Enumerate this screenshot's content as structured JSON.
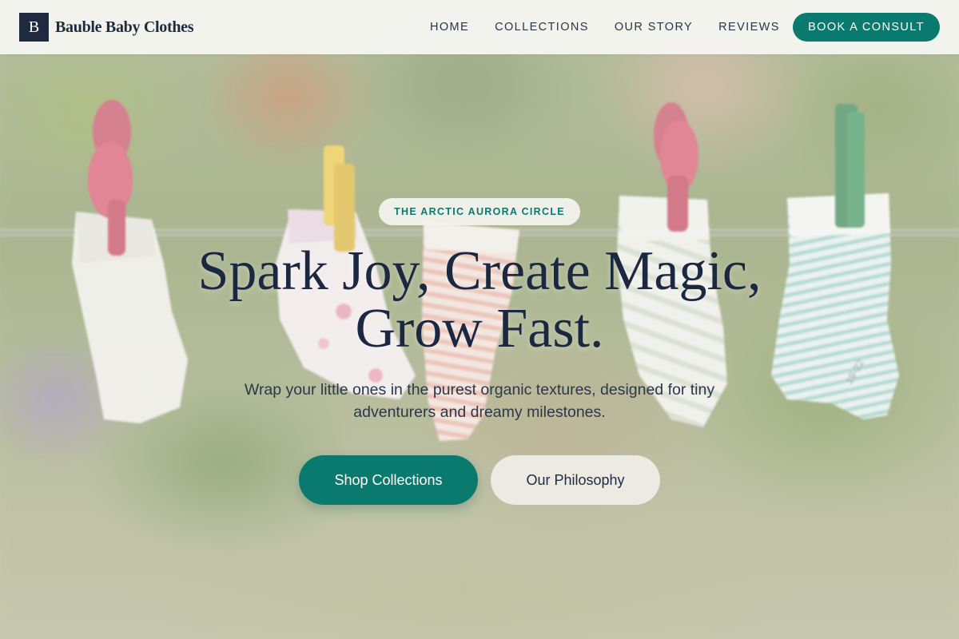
{
  "brand": {
    "mark": "B",
    "name": "Bauble Baby Clothes"
  },
  "nav": {
    "items": [
      {
        "label": "HOME"
      },
      {
        "label": "COLLECTIONS"
      },
      {
        "label": "OUR STORY"
      },
      {
        "label": "REVIEWS"
      }
    ],
    "cta_label": "BOOK A CONSULT"
  },
  "hero": {
    "eyebrow": "THE ARCTIC AURORA CIRCLE",
    "title_line1": "Spark Joy, Create Magic,",
    "title_line2": "Grow Fast.",
    "subtitle": "Wrap your little ones in the purest organic textures, designed for tiny adventurers and dreamy milestones.",
    "primary_button": "Shop Collections",
    "secondary_button": "Our Philosophy"
  },
  "photo": {
    "subject": "baby-socks-on-clothesline",
    "sock_size_tag": "19-22"
  },
  "colors": {
    "accent": "#0b7a6e",
    "navy": "#1f2a3e",
    "header_bg": "#f7f6f3"
  }
}
